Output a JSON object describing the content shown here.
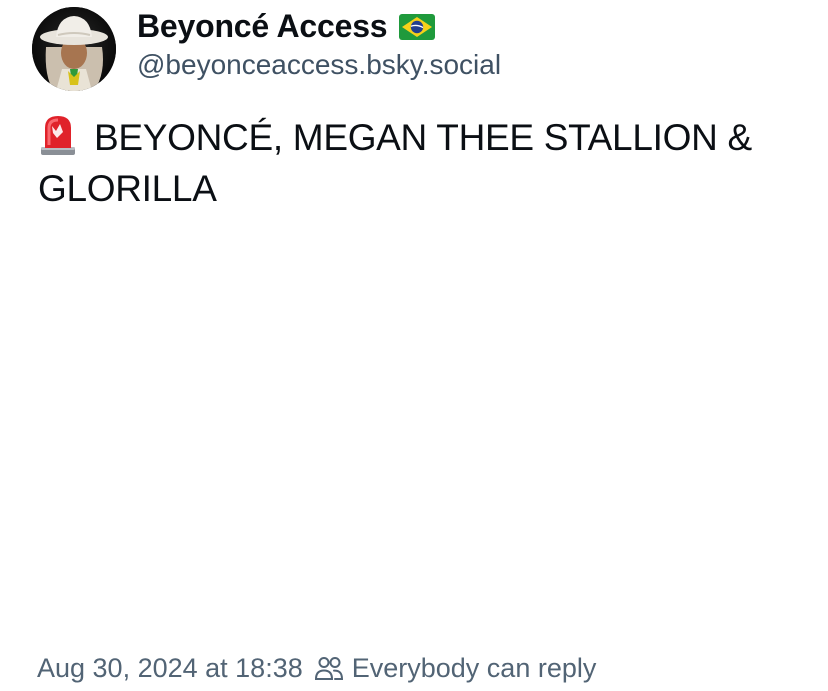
{
  "post": {
    "author": {
      "display_name": "Beyoncé Access",
      "flag_icon": "brazil-flag-icon",
      "handle": "@beyonceaccess.bsky.social"
    },
    "text_prefix_icon": "rotating-light-siren-icon",
    "text": "BEYONCÉ, MEGAN THEE STALLION & GLORILLA",
    "timestamp": "Aug 30, 2024 at 18:38",
    "reply_setting_icon": "people-icon",
    "reply_setting": "Everybody can reply"
  },
  "colors": {
    "text_primary": "#0b0f14",
    "text_secondary": "#3f5163",
    "meta": "#526475",
    "background": "#ffffff"
  }
}
